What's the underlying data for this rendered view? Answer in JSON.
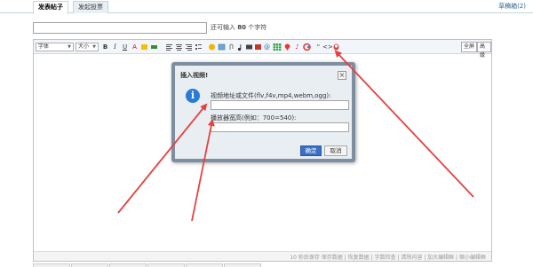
{
  "tabs": [
    {
      "label": "发表帖子",
      "active": true
    },
    {
      "label": "发起投票",
      "active": false
    }
  ],
  "draft_link": "草稿箱(2)",
  "title_field": {
    "value": ""
  },
  "title_hint": {
    "prefix": "还可输入",
    "count": "80",
    "suffix": "个字符"
  },
  "toolbar": {
    "font_select": "字体",
    "size_select": "大小",
    "bold": "B",
    "italic": "I",
    "underline": "U",
    "quote": "“",
    "code": "<>",
    "fullscreen": "全屏",
    "advanced": "高级"
  },
  "status_bar": "10 秒后保存 保存数据 | 恢复数据 | 字数检查 | 清除内容 | 加大编辑框 | 缩小编辑框",
  "dialog": {
    "title": "插入视频!",
    "close": "×",
    "label_url": "视频地址或文件(flv,f4v,mp4,webm,ogg):",
    "label_size": "播放器宽高(例如：700=540):",
    "ok": "确定",
    "cancel": "取消",
    "url_value": "",
    "size_value": ""
  },
  "colors": {
    "accent": "#3a6fc4",
    "arrow": "#e64040",
    "dialog_border": "#7d8ea0"
  }
}
